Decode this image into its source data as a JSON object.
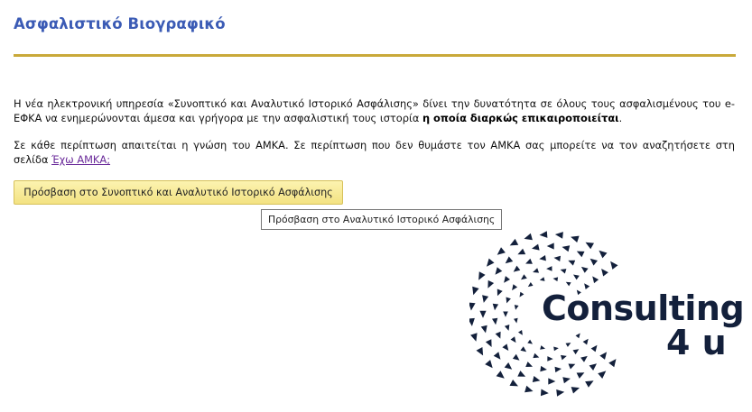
{
  "page": {
    "title": "Ασφαλιστικό Βιογραφικό"
  },
  "intro": {
    "text_before_bold": "Η νέα ηλεκτρονική υπηρεσία «Συνοπτικό και Αναλυτικό Ιστορικό Ασφάλισης» δίνει την δυνατότητα σε όλους τους ασφαλισμένους του e-ΕΦΚΑ να ενημερώνονται άμεσα και γρήγορα με την ασφαλιστική τους ιστορία ",
    "bold_text": "η οποία διαρκώς επικαιροποιείται",
    "text_after_bold": "."
  },
  "amka_notice": {
    "text": "Σε κάθε περίπτωση απαιτείται η γνώση του ΑΜΚΑ. Σε περίπτωση που δεν θυμάστε τον ΑΜΚΑ σας μπορείτε να τον αναζητήσετε στη σελίδα ",
    "link_label": "Έχω ΑΜΚΑ;"
  },
  "access_button": {
    "label": "Πρόσβαση στο Συνοπτικό και Αναλυτικό Ιστορικό Ασφάλισης"
  },
  "tooltip": {
    "text": "Πρόσβαση στο Αναλυτικό Ιστορικό Ασφάλισης"
  },
  "logo": {
    "word": "Consulting",
    "sub": "4 u",
    "color": "#13203b"
  },
  "colors": {
    "title": "#3b5bb5",
    "rule": "#c9a93a",
    "link": "#6a2a9a",
    "button_bg": "#f6e68f"
  }
}
